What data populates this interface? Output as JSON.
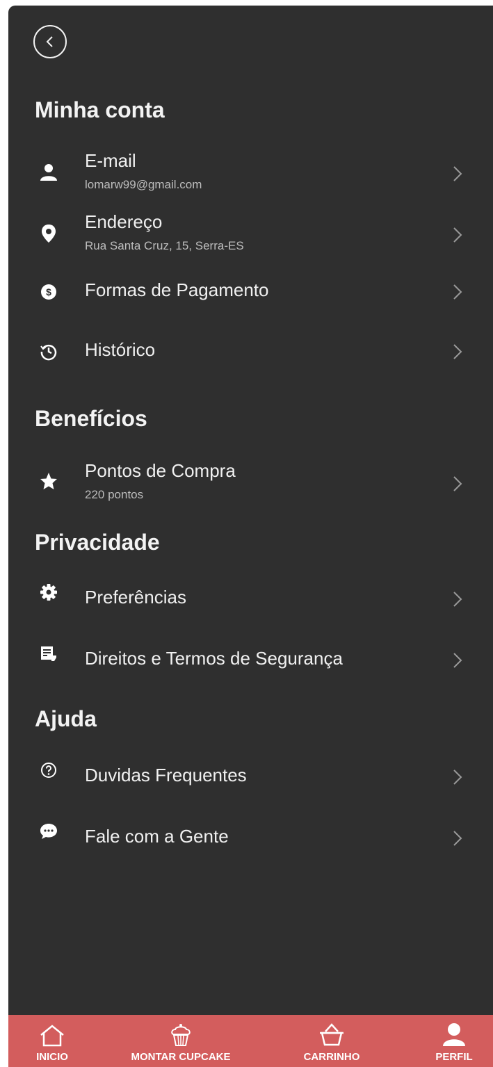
{
  "header": {
    "back_icon": "back-arrow-circle-icon"
  },
  "sections": {
    "account": {
      "title": "Minha conta",
      "items": [
        {
          "label": "E-mail",
          "sub": "lomarw99@gmail.com",
          "icon": "user-icon"
        },
        {
          "label": "Endereço",
          "sub": "Rua Santa Cruz, 15, Serra-ES",
          "icon": "location-pin-icon"
        },
        {
          "label": "Formas de Pagamento",
          "icon": "dollar-coin-icon"
        },
        {
          "label": "Histórico",
          "icon": "history-icon"
        }
      ]
    },
    "benefits": {
      "title": "Benefícios",
      "items": [
        {
          "label": "Pontos de Compra",
          "sub": "220 pontos",
          "icon": "star-icon"
        }
      ]
    },
    "privacy": {
      "title": "Privacidade",
      "items": [
        {
          "label": "Preferências",
          "icon": "gear-icon"
        },
        {
          "label": "Direitos e Termos de Segurança",
          "icon": "document-icon"
        }
      ]
    },
    "help": {
      "title": "Ajuda",
      "items": [
        {
          "label": "Duvidas Frequentes",
          "icon": "help-circle-icon"
        },
        {
          "label": "Fale com a Gente",
          "icon": "chat-bubble-icon"
        }
      ]
    }
  },
  "bottom_nav": {
    "items": [
      {
        "label": "INICIO",
        "icon": "home-icon"
      },
      {
        "label": "MONTAR CUPCAKE",
        "icon": "cupcake-icon"
      },
      {
        "label": "CARRINHO",
        "icon": "basket-icon"
      },
      {
        "label": "PERFIL",
        "icon": "profile-icon"
      }
    ]
  },
  "colors": {
    "background": "#2f2f2f",
    "nav": "#d35d5d",
    "text": "#f0f0f0",
    "subtext": "#bdbdbd"
  }
}
